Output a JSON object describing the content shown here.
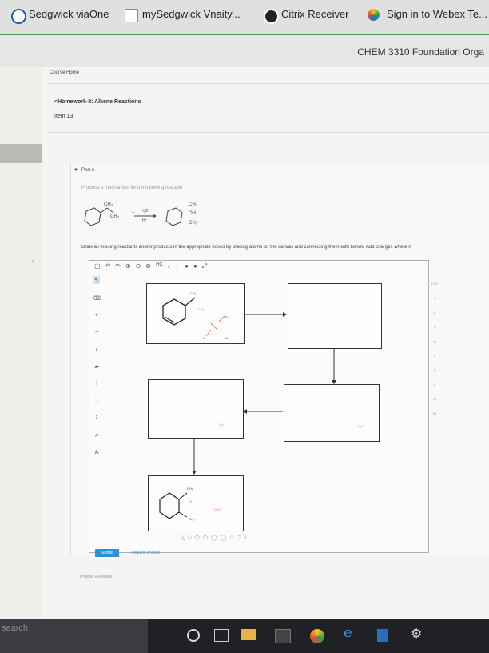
{
  "bookmarks": [
    {
      "label": "Sedgwick viaOne",
      "icon": "sedgwick-icon"
    },
    {
      "label": "mySedgwick Vnaity...",
      "icon": "page-icon"
    },
    {
      "label": "Citrix Receiver",
      "icon": "citrix-icon"
    },
    {
      "label": "Sign in to Webex Te...",
      "icon": "webex-icon"
    }
  ],
  "app": {
    "course_title": "CHEM 3310 Foundation Orga"
  },
  "nav": {
    "breadcrumb": "Course Home",
    "back_link": "<Homework-8: Alkene Reactions",
    "item": "Item 13"
  },
  "part": {
    "label": "Part A",
    "prompt": "Propose a mechanism for the following reaction",
    "reagent_top": "H₂O",
    "reagent_bottom": "H⁺",
    "instructions": "Draw all missing reactants and/or products in the appropriate boxes by placing atoms on the canvas and connecting them with bonds. Add charges where n"
  },
  "editor": {
    "toolbar_icons": [
      "new-icon",
      "undo-icon",
      "redo-icon",
      "zoom-in-icon",
      "zoom-out-icon",
      "zoom-fit-icon",
      "h-c-label",
      "template-icon",
      "template2-icon",
      "info-icon",
      "help-icon",
      "expand-icon"
    ],
    "left_tools": [
      "select-icon",
      "eraser-icon",
      "charge-plus-icon",
      "charge-minus-icon",
      "bond-icon",
      "bold-bond-icon",
      "hash-bond-icon",
      "ring-icon",
      "chain-icon",
      "arrow-icon",
      "text-icon"
    ],
    "right_atoms": [
      "H",
      "C",
      "N",
      "O",
      "S",
      "P",
      "F",
      "Cl",
      "Br",
      "I"
    ],
    "right_header": "H+H",
    "bottom_tools": [
      "triangle-icon",
      "square-icon",
      "pentagon-icon",
      "hexagon-icon",
      "heptagon-icon",
      "octagon-icon",
      "circle-icon",
      "benzene-icon",
      "download-icon"
    ],
    "labels": {
      "ch3": "CH₃",
      "h2o_label": "H₂O",
      "h": "H",
      "oh": "OH",
      "h2o_plus": "H₂O⁺"
    }
  },
  "actions": {
    "submit": "Submit",
    "request_answer": "Request Answer",
    "provide_feedback": "Provide Feedback"
  },
  "taskbar": {
    "search_text": "search"
  },
  "colors": {
    "accent_green": "#3f9c55",
    "submit_blue": "#2d8fd8",
    "arrow": "#333333",
    "pink_label": "#e07a7a"
  }
}
